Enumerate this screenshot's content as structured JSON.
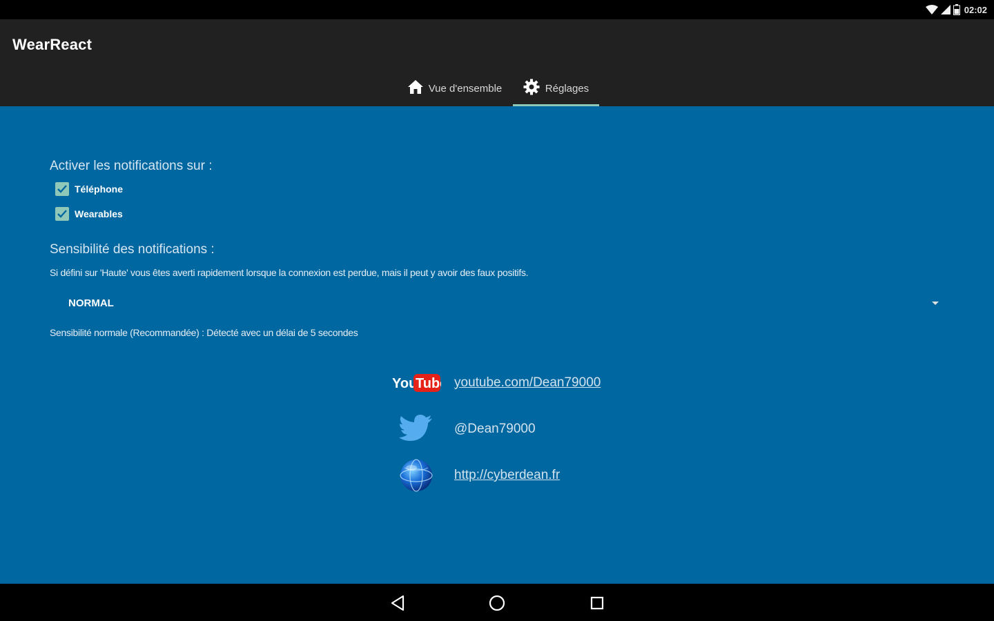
{
  "status_bar": {
    "time": "02:02",
    "icons": [
      "wifi-icon",
      "signal-icon",
      "battery-icon"
    ]
  },
  "app_bar": {
    "title": "WearReact",
    "tabs": [
      {
        "label": "Vue d'ensemble",
        "icon": "home-icon",
        "selected": false
      },
      {
        "label": "Réglages",
        "icon": "gear-icon",
        "selected": true
      }
    ]
  },
  "settings": {
    "notifications_heading": "Activer les notifications sur :",
    "checkboxes": [
      {
        "label": "Téléphone",
        "checked": true
      },
      {
        "label": "Wearables",
        "checked": true
      }
    ],
    "sensitivity_heading": "Sensibilité des notifications :",
    "sensitivity_description": "Si défini sur 'Haute' vous êtes averti rapidement lorsque la connexion est perdue, mais il peut y avoir des faux positifs.",
    "sensitivity_selected": "NORMAL",
    "sensitivity_detail": "Sensibilité normale (Recommandée) : Détecté avec un délai de 5 secondes"
  },
  "links": {
    "youtube": {
      "icon": "youtube-logo",
      "logo_you": "You",
      "logo_tube": "Tube",
      "text": "youtube.com/Dean79000"
    },
    "twitter": {
      "icon": "twitter-bird-icon",
      "text": "@Dean79000"
    },
    "website": {
      "icon": "globe-icon",
      "text": "http://cyberdean.fr"
    }
  },
  "colors": {
    "background": "#0067A0",
    "app_bar": "#212121",
    "accent": "#8FC8B8",
    "youtube_red": "#E62117",
    "twitter_blue": "#55ACEE"
  },
  "nav_bar": {
    "buttons": [
      "back-icon",
      "home-circle-icon",
      "recents-icon"
    ]
  }
}
